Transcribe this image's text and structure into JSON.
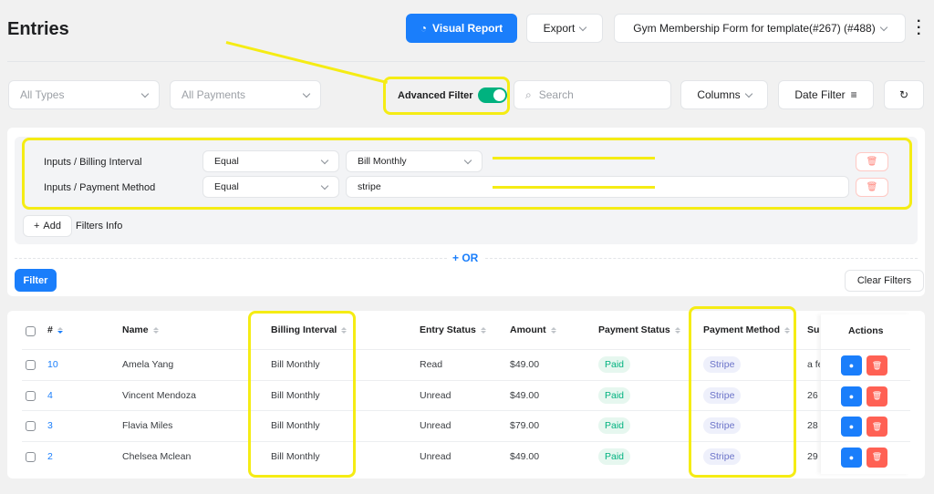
{
  "header": {
    "title": "Entries",
    "visual_report": "Visual Report",
    "export": "Export",
    "form_select": "Gym Membership Form for template(#267) (#488)"
  },
  "toolbar": {
    "types_placeholder": "All Types",
    "payments_placeholder": "All Payments",
    "advanced_filter": "Advanced Filter",
    "advanced_filter_on": true,
    "search_placeholder": "Search",
    "columns": "Columns",
    "date_filter": "Date Filter"
  },
  "filters": {
    "rows": [
      {
        "field": "Inputs / Billing Interval",
        "operator": "Equal",
        "value": "Bill Monthly"
      },
      {
        "field": "Inputs / Payment Method",
        "operator": "Equal",
        "value": "stripe"
      }
    ],
    "add": "Add",
    "info": "Filters Info",
    "or": "OR",
    "filter_button": "Filter",
    "clear": "Clear Filters"
  },
  "table": {
    "headers": {
      "id": "#",
      "name": "Name",
      "billing": "Billing Interval",
      "entry_status": "Entry Status",
      "amount": "Amount",
      "payment_status": "Payment Status",
      "payment_method": "Payment Method",
      "sub": "Sub",
      "actions": "Actions"
    },
    "rows": [
      {
        "id": "10",
        "name": "Amela Yang",
        "billing": "Bill Monthly",
        "entry_status": "Read",
        "amount": "$49.00",
        "payment_status": "Paid",
        "payment_method": "Stripe",
        "sub": "a fe"
      },
      {
        "id": "4",
        "name": "Vincent Mendoza",
        "billing": "Bill Monthly",
        "entry_status": "Unread",
        "amount": "$49.00",
        "payment_status": "Paid",
        "payment_method": "Stripe",
        "sub": "26"
      },
      {
        "id": "3",
        "name": "Flavia Miles",
        "billing": "Bill Monthly",
        "entry_status": "Unread",
        "amount": "$79.00",
        "payment_status": "Paid",
        "payment_method": "Stripe",
        "sub": "28"
      },
      {
        "id": "2",
        "name": "Chelsea Mclean",
        "billing": "Bill Monthly",
        "entry_status": "Unread",
        "amount": "$49.00",
        "payment_status": "Paid",
        "payment_method": "Stripe",
        "sub": "29"
      }
    ]
  },
  "colors": {
    "primary": "#1a7efb",
    "toggle": "#00b27f",
    "danger": "#ff6154",
    "highlight": "#f5ec14"
  }
}
